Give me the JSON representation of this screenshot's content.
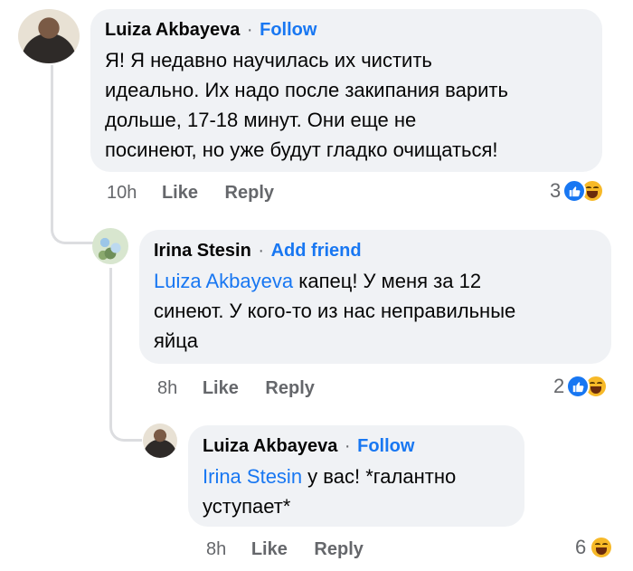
{
  "comments": [
    {
      "author": "Luiza Akbayeva",
      "action": "Follow",
      "text": "Я! Я недавно научилась их чистить идеально. Их надо после закипания варить дольше,  17-18 минут. Они еще не посинеют, но уже будут гладко очищаться!",
      "lines": [
        "Я! Я недавно научилась их чистить",
        "идеально. Их надо после закипания варить",
        "дольше,  17-18 минут. Они еще не",
        "посинеют, но уже будут гладко очищаться!"
      ],
      "time": "10h",
      "like": "Like",
      "reply": "Reply",
      "reaction_count": "3",
      "reactions": [
        "like-icon",
        "haha-icon"
      ]
    },
    {
      "author": "Irina Stesin",
      "action": "Add friend",
      "mention": "Luiza Akbayeva",
      "lines": [
        " капец! У меня за 12",
        "синеют. У кого-то из нас неправильные",
        "яйца"
      ],
      "time": "8h",
      "like": "Like",
      "reply": "Reply",
      "reaction_count": "2",
      "reactions": [
        "like-icon",
        "haha-icon"
      ]
    },
    {
      "author": "Luiza Akbayeva",
      "action": "Follow",
      "mention": "Irina Stesin",
      "lines": [
        " у вас! *галантно",
        "уступает*"
      ],
      "time": "8h",
      "like": "Like",
      "reply": "Reply",
      "reaction_count": "6",
      "reactions": [
        "haha-icon"
      ]
    }
  ],
  "separator": "·"
}
